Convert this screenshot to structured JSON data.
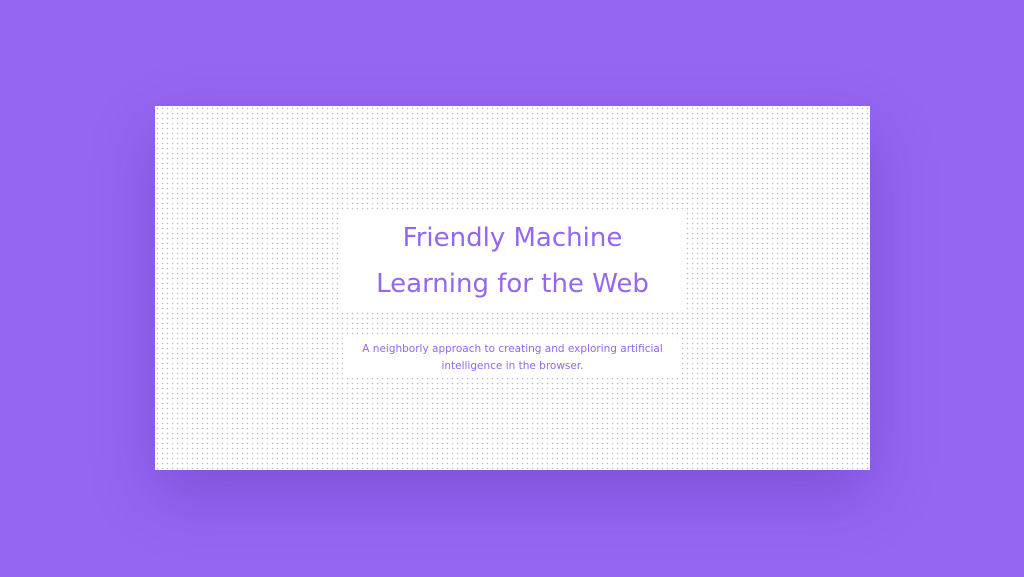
{
  "hero": {
    "title_line1": "Friendly Machine",
    "title_line2": "Learning for the Web",
    "subtitle_line1": "A neighborly approach to creating and exploring artificial",
    "subtitle_line2": "intelligence in the browser."
  },
  "colors": {
    "background": "#9566f2",
    "accent": "#9566f2",
    "card": "#ffffff"
  }
}
